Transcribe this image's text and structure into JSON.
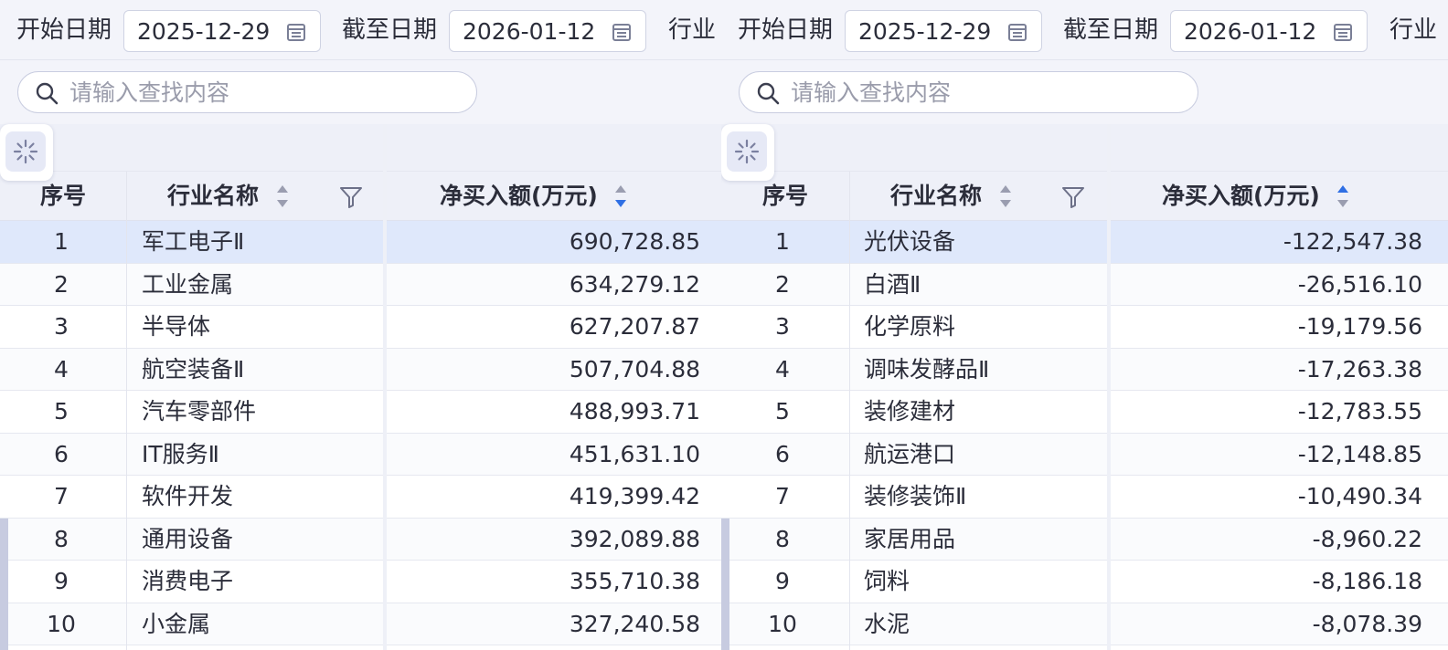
{
  "filters": {
    "start_label": "开始日期",
    "start_value": "2025-12-29",
    "end_label": "截至日期",
    "end_value": "2026-01-12",
    "industry_label": "行业",
    "search_placeholder": "请输入查找内容"
  },
  "columns": {
    "index": "序号",
    "industry": "行业名称",
    "net_buy": "净买入额(万元)"
  },
  "colors": {
    "accent": "#2f6fe4",
    "selected_row": "#dfe8fb",
    "header_bg": "#eef0f8"
  },
  "left_table": {
    "sort_direction": "descending",
    "rows": [
      {
        "index": "1",
        "name": "军工电子Ⅱ",
        "value": "690,728.85"
      },
      {
        "index": "2",
        "name": "工业金属",
        "value": "634,279.12"
      },
      {
        "index": "3",
        "name": "半导体",
        "value": "627,207.87"
      },
      {
        "index": "4",
        "name": "航空装备Ⅱ",
        "value": "507,704.88"
      },
      {
        "index": "5",
        "name": "汽车零部件",
        "value": "488,993.71"
      },
      {
        "index": "6",
        "name": "IT服务Ⅱ",
        "value": "451,631.10"
      },
      {
        "index": "7",
        "name": "软件开发",
        "value": "419,399.42"
      },
      {
        "index": "8",
        "name": "通用设备",
        "value": "392,089.88"
      },
      {
        "index": "9",
        "name": "消费电子",
        "value": "355,710.38"
      },
      {
        "index": "10",
        "name": "小金属",
        "value": "327,240.58"
      }
    ]
  },
  "right_table": {
    "sort_direction": "ascending",
    "rows": [
      {
        "index": "1",
        "name": "光伏设备",
        "value": "-122,547.38"
      },
      {
        "index": "2",
        "name": "白酒Ⅱ",
        "value": "-26,516.10"
      },
      {
        "index": "3",
        "name": "化学原料",
        "value": "-19,179.56"
      },
      {
        "index": "4",
        "name": "调味发酵品Ⅱ",
        "value": "-17,263.38"
      },
      {
        "index": "5",
        "name": "装修建材",
        "value": "-12,783.55"
      },
      {
        "index": "6",
        "name": "航运港口",
        "value": "-12,148.85"
      },
      {
        "index": "7",
        "name": "装修装饰Ⅱ",
        "value": "-10,490.34"
      },
      {
        "index": "8",
        "name": "家居用品",
        "value": "-8,960.22"
      },
      {
        "index": "9",
        "name": "饲料",
        "value": "-8,186.18"
      },
      {
        "index": "10",
        "name": "水泥",
        "value": "-8,078.39"
      }
    ]
  }
}
